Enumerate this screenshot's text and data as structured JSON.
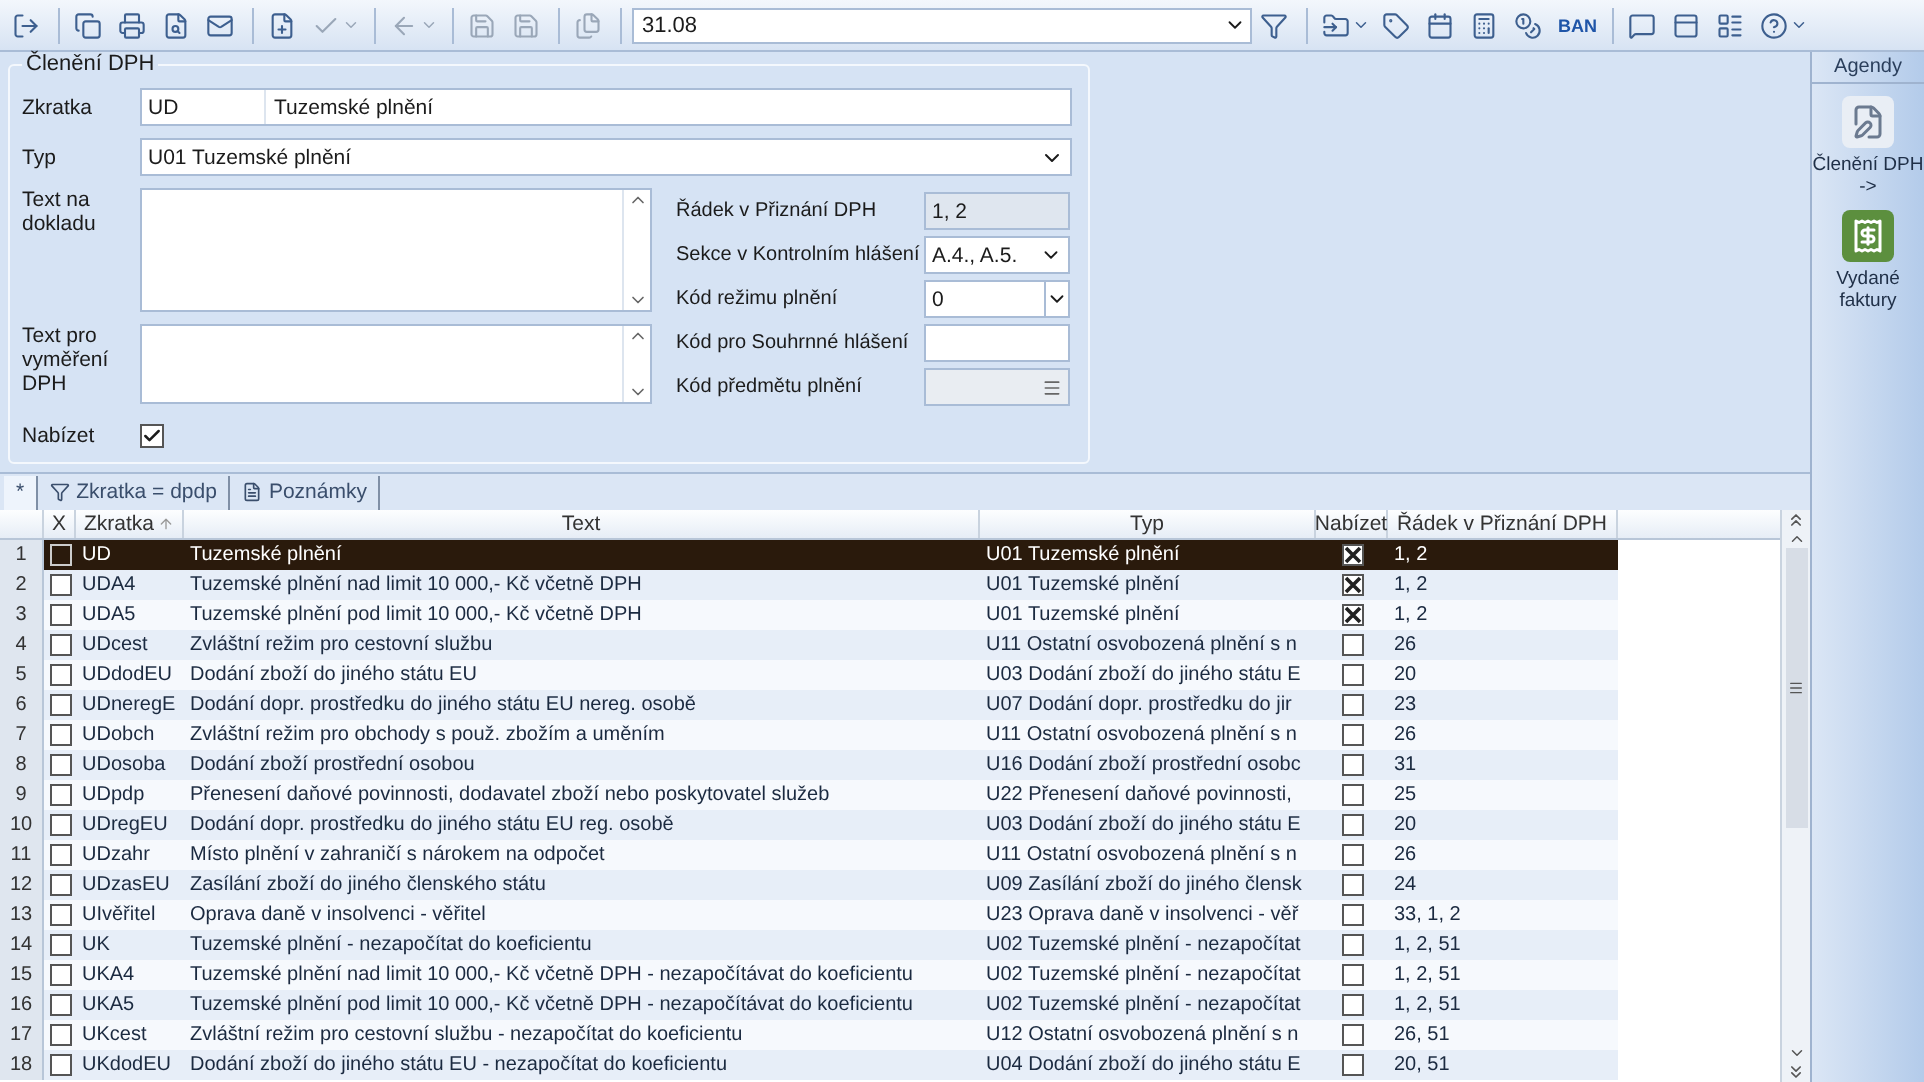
{
  "toolbar": {
    "items": [
      {
        "kind": "button",
        "disabled": false
      },
      {
        "kind": "separator"
      },
      {
        "kind": "button",
        "disabled": false
      },
      {
        "kind": "button",
        "disabled": false
      },
      {
        "kind": "button",
        "disabled": false
      },
      {
        "kind": "button",
        "disabled": false
      },
      {
        "kind": "separator"
      },
      {
        "kind": "button",
        "disabled": false
      },
      {
        "kind": "dropdown",
        "disabled": true
      },
      {
        "kind": "separator"
      },
      {
        "kind": "dropdown",
        "disabled": true
      },
      {
        "kind": "separator"
      },
      {
        "kind": "button",
        "disabled": true
      },
      {
        "kind": "button",
        "disabled": true
      },
      {
        "kind": "separator"
      },
      {
        "kind": "button",
        "disabled": true
      },
      {
        "kind": "separator"
      },
      {
        "kind": "combo",
        "value": "31.08"
      },
      {
        "kind": "button",
        "disabled": false
      },
      {
        "kind": "separator"
      },
      {
        "kind": "dropdown",
        "disabled": false
      },
      {
        "kind": "button",
        "disabled": false
      },
      {
        "kind": "button",
        "disabled": false
      },
      {
        "kind": "button",
        "disabled": false
      },
      {
        "kind": "button",
        "disabled": false
      },
      {
        "kind": "text",
        "label": "BAN",
        "disabled": false
      },
      {
        "kind": "separator"
      },
      {
        "kind": "button",
        "disabled": false
      },
      {
        "kind": "button",
        "disabled": false
      },
      {
        "kind": "button",
        "disabled": false
      },
      {
        "kind": "dropdown",
        "disabled": false
      }
    ]
  },
  "form": {
    "title": "Členění DPH",
    "code": {
      "label": "Zkratka",
      "value": "UD",
      "name": "Tuzemské plnění"
    },
    "type": {
      "label": "Typ",
      "value": "U01 Tuzemské plnění"
    },
    "doc_text": {
      "label": "Text na dokladu"
    },
    "tax_text": {
      "label": "Text pro vyměření DPH"
    },
    "offer": {
      "label": "Nabízet",
      "checked": true
    },
    "right": [
      {
        "kind": "readonly",
        "label": "Řádek v Přiznání DPH",
        "value": "1, 2"
      },
      {
        "kind": "select",
        "label": "Sekce v Kontrolním hlášení",
        "value": "A.4., A.5."
      },
      {
        "kind": "combo",
        "label": "Kód režimu plnění",
        "value": "0"
      },
      {
        "kind": "input",
        "label": "Kód pro Souhrnné hlášení"
      },
      {
        "kind": "picker",
        "label": "Kód předmětu plnění"
      }
    ]
  },
  "tabs": [
    {
      "kind": "star",
      "label": "*",
      "selected": true
    },
    {
      "kind": "filter",
      "label": "Zkratka = dpdp",
      "selected": false
    },
    {
      "kind": "note",
      "label": "Poznámky",
      "selected": false
    }
  ],
  "table": {
    "columns": [
      "X",
      "Zkratka",
      "Text",
      "Typ",
      "Nabízet",
      "Řádek v Přiznání DPH"
    ],
    "rows": [
      {
        "n": "1",
        "selected": true,
        "marked": false,
        "code": "UD",
        "text": "Tuzemské plnění",
        "type": "U01 Tuzemské plnění",
        "offered": true,
        "line": "1, 2"
      },
      {
        "n": "2",
        "selected": false,
        "marked": false,
        "code": "UDA4",
        "text": "Tuzemské plnění nad limit 10 000,- Kč včetně DPH",
        "type": "U01 Tuzemské plnění",
        "offered": true,
        "line": "1, 2"
      },
      {
        "n": "3",
        "selected": false,
        "marked": false,
        "code": "UDA5",
        "text": "Tuzemské plnění pod limit 10 000,- Kč včetně DPH",
        "type": "U01 Tuzemské plnění",
        "offered": true,
        "line": "1, 2"
      },
      {
        "n": "4",
        "selected": false,
        "marked": false,
        "code": "UDcest",
        "text": "Zvláštní režim pro cestovní službu",
        "type": "U11 Ostatní osvobozená plnění s n",
        "offered": false,
        "line": "26"
      },
      {
        "n": "5",
        "selected": false,
        "marked": false,
        "code": "UDdodEU",
        "text": "Dodání zboží do jiného státu EU",
        "type": "U03 Dodání zboží do jiného státu E",
        "offered": false,
        "line": "20"
      },
      {
        "n": "6",
        "selected": false,
        "marked": false,
        "code": "UDneregE",
        "text": "Dodání dopr. prostředku do jiného státu EU nereg. osobě",
        "type": "U07 Dodání dopr. prostředku do jir",
        "offered": false,
        "line": "23"
      },
      {
        "n": "7",
        "selected": false,
        "marked": false,
        "code": "UDobch",
        "text": "Zvláštní režim pro obchody s použ. zbožím a uměním",
        "type": "U11 Ostatní osvobozená plnění s n",
        "offered": false,
        "line": "26"
      },
      {
        "n": "8",
        "selected": false,
        "marked": false,
        "code": "UDosoba",
        "text": "Dodání zboží prostřední osobou",
        "type": "U16 Dodání zboží prostřední osobc",
        "offered": false,
        "line": "31"
      },
      {
        "n": "9",
        "selected": false,
        "marked": false,
        "code": "UDpdp",
        "text": "Přenesení daňové povinnosti, dodavatel zboží nebo poskytovatel služeb",
        "type": "U22 Přenesení daňové povinnosti,",
        "offered": false,
        "line": "25"
      },
      {
        "n": "10",
        "selected": false,
        "marked": false,
        "code": "UDregEU",
        "text": "Dodání dopr. prostředku do jiného státu EU reg. osobě",
        "type": "U03 Dodání zboží do jiného státu E",
        "offered": false,
        "line": "20"
      },
      {
        "n": "11",
        "selected": false,
        "marked": false,
        "code": "UDzahr",
        "text": "Místo plnění v zahraničí s nárokem na odpočet",
        "type": "U11 Ostatní osvobozená plnění s n",
        "offered": false,
        "line": "26"
      },
      {
        "n": "12",
        "selected": false,
        "marked": false,
        "code": "UDzasEU",
        "text": "Zasílání zboží do jiného členského státu",
        "type": "U09 Zasílání zboží do jiného člensk",
        "offered": false,
        "line": "24"
      },
      {
        "n": "13",
        "selected": false,
        "marked": false,
        "code": "UIvěřitel",
        "text": "Oprava daně v insolvenci - věřitel",
        "type": "U23 Oprava daně v insolvenci - věř",
        "offered": false,
        "line": "33, 1, 2"
      },
      {
        "n": "14",
        "selected": false,
        "marked": false,
        "code": "UK",
        "text": "Tuzemské plnění - nezapočítat do koeficientu",
        "type": "U02 Tuzemské plnění - nezapočítat",
        "offered": false,
        "line": "1, 2, 51"
      },
      {
        "n": "15",
        "selected": false,
        "marked": false,
        "code": "UKA4",
        "text": "Tuzemské plnění nad limit 10 000,- Kč včetně DPH - nezapočítávat do koeficientu",
        "type": "U02 Tuzemské plnění - nezapočítat",
        "offered": false,
        "line": "1, 2, 51"
      },
      {
        "n": "16",
        "selected": false,
        "marked": false,
        "code": "UKA5",
        "text": "Tuzemské plnění pod limit 10 000,- Kč včetně DPH - nezapočítávat do koeficientu",
        "type": "U02 Tuzemské plnění - nezapočítat",
        "offered": false,
        "line": "1, 2, 51"
      },
      {
        "n": "17",
        "selected": false,
        "marked": false,
        "code": "UKcest",
        "text": "Zvláštní režim pro cestovní službu - nezapočítat do koeficientu",
        "type": "U12 Ostatní osvobozená plnění s n",
        "offered": false,
        "line": "26, 51"
      },
      {
        "n": "18",
        "selected": false,
        "marked": false,
        "code": "UKdodEU",
        "text": "Dodání zboží do jiného státu EU - nezapočítat do koeficientu",
        "type": "U04 Dodání zboží do jiného státu E",
        "offered": false,
        "line": "20, 51"
      }
    ]
  },
  "agendas": {
    "title": "Agendy",
    "items": [
      {
        "kind": "vat",
        "label": "Členění DPH ->"
      },
      {
        "kind": "invoice",
        "label": "Vydané faktury"
      }
    ]
  }
}
